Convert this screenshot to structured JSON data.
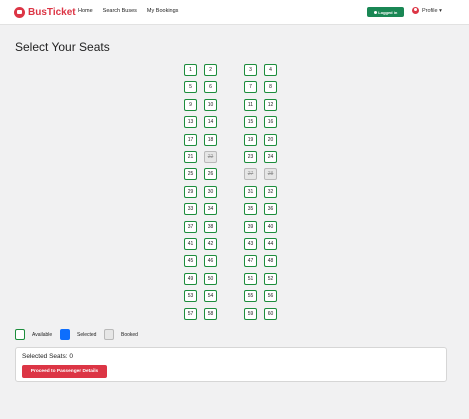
{
  "navbar": {
    "brand": "BusTicket",
    "links": [
      "Home",
      "Search Buses",
      "My Bookings"
    ],
    "login_label": "Logged in",
    "profile_label": "Profile ▾"
  },
  "page_title": "Select Your Seats",
  "seat_columns": [
    {
      "seats": [
        "1",
        "5",
        "9",
        "13",
        "17",
        "21",
        "25",
        "29",
        "33",
        "37",
        "41",
        "45",
        "49",
        "53",
        "57"
      ]
    },
    {
      "seats": [
        "2",
        "6",
        "10",
        "14",
        "18",
        "22",
        "26",
        "30",
        "34",
        "38",
        "42",
        "46",
        "50",
        "54",
        "58"
      ]
    },
    {
      "seats": [
        "3",
        "7",
        "11",
        "15",
        "19",
        "23",
        "27",
        "31",
        "35",
        "39",
        "43",
        "47",
        "51",
        "55",
        "59"
      ]
    },
    {
      "seats": [
        "4",
        "8",
        "12",
        "16",
        "20",
        "24",
        "28",
        "32",
        "36",
        "40",
        "44",
        "48",
        "52",
        "56",
        "60"
      ]
    }
  ],
  "booked_seats": [
    "22",
    "27",
    "28"
  ],
  "legend": {
    "available": "Available",
    "selected": "Selected",
    "booked": "Booked"
  },
  "summary": {
    "selected_text": "Selected Seats: 0",
    "proceed_label": "Proceed to Passenger Details"
  },
  "colors": {
    "brand": "#dc3545",
    "available_border": "#1c8d3c",
    "selected": "#0d6efd",
    "booked": "#e6e6e6",
    "login_button": "#198754"
  }
}
